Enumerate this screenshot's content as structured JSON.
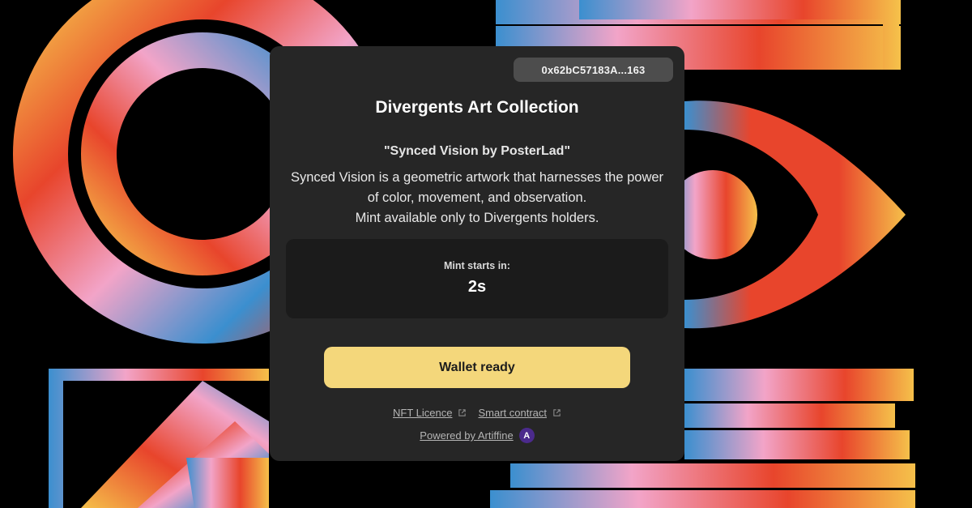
{
  "wallet": {
    "address": "0x62bC57183A...163"
  },
  "collection": {
    "title": "Divergents Art Collection"
  },
  "artwork": {
    "name": "\"Synced Vision by PosterLad\"",
    "description_lines": [
      "Synced Vision is a geometric artwork that harnesses the power",
      "of color, movement, and observation.",
      "Mint available only to Divergents holders."
    ]
  },
  "countdown": {
    "label": "Mint starts in:",
    "value": "2s"
  },
  "actions": {
    "wallet_button": "Wallet ready"
  },
  "footer": {
    "links": [
      {
        "label": "NFT Licence",
        "icon": "external-link-icon"
      },
      {
        "label": "Smart contract",
        "icon": "external-link-icon"
      }
    ],
    "powered_by": "Powered by Artiffine",
    "logo_letter": "A"
  },
  "colors": {
    "card_bg": "#262626",
    "countdown_bg": "#1b1b1b",
    "button_bg": "#f4d77b",
    "chip_bg": "#4d4d4d",
    "logo_bg": "#4b2a8c"
  }
}
